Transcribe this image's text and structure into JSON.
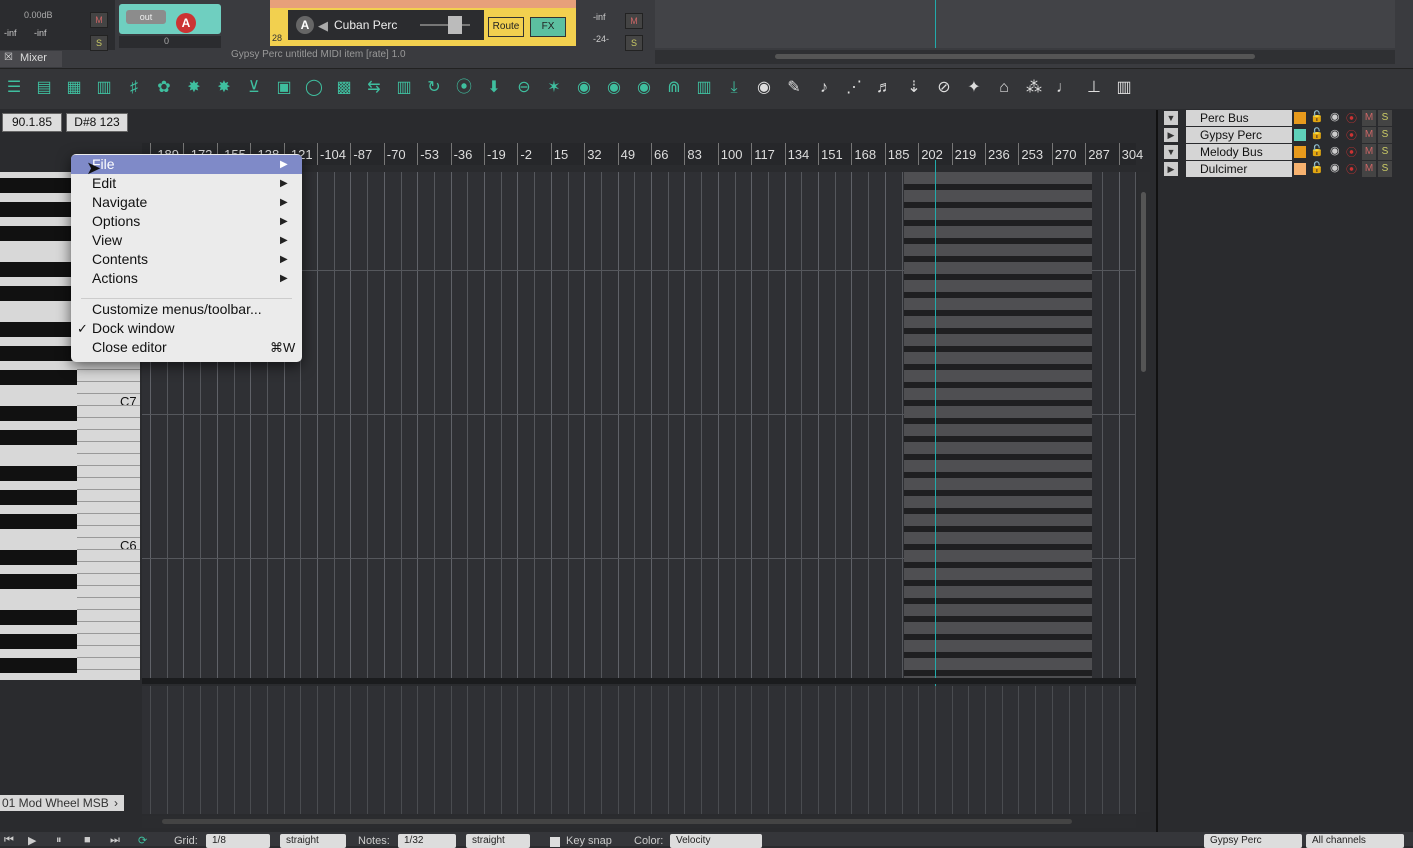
{
  "mixer": {
    "level": "0.00dB",
    "inf_left": "-inf",
    "inf_right": "-inf",
    "out_label": "out",
    "a_label": "A",
    "mute": "M",
    "solo": "S",
    "pan_value": "0",
    "tab_label": "Mixer",
    "track_number": "28",
    "track_name": "Cuban Perc",
    "route_label": "Route",
    "fx_label": "FX",
    "meter_top": "-inf",
    "meter_bottom": "-24-"
  },
  "editor_title": "Gypsy Perc untitled MIDI item [rate] 1.0",
  "position": {
    "time": "90.1.85",
    "note": "D#8",
    "velocity": "123"
  },
  "ruler_ticks": [
    "-189",
    "-172",
    "-155",
    "-138",
    "-121",
    "-104",
    "-87",
    "-70",
    "-53",
    "-36",
    "-19",
    "-2",
    "15",
    "32",
    "49",
    "66",
    "83",
    "100",
    "117",
    "134",
    "151",
    "168",
    "185",
    "202",
    "219",
    "236",
    "253",
    "270",
    "287",
    "304"
  ],
  "key_labels": {
    "c7": "C7",
    "c6": "C6"
  },
  "cc_lane": "01 Mod Wheel MSB",
  "tracks": [
    {
      "name": "Perc Bus",
      "color": "#e89a1c",
      "folder": true
    },
    {
      "name": "Gypsy Perc",
      "color": "#5fd1b9",
      "folder": false
    },
    {
      "name": "Melody Bus",
      "color": "#e89a1c",
      "folder": true
    },
    {
      "name": "Dulcimer",
      "color": "#f7b26f",
      "folder": false
    }
  ],
  "context_menu": {
    "items": [
      {
        "label": "File",
        "submenu": true
      },
      {
        "label": "Edit",
        "submenu": true
      },
      {
        "label": "Navigate",
        "submenu": true
      },
      {
        "label": "Options",
        "submenu": true
      },
      {
        "label": "View",
        "submenu": true
      },
      {
        "label": "Contents",
        "submenu": true
      },
      {
        "label": "Actions",
        "submenu": true
      }
    ],
    "customize": "Customize menus/toolbar...",
    "dock": "Dock window",
    "dock_check": "✓",
    "close": "Close editor",
    "close_shortcut": "⌘W",
    "arrow": "▶"
  },
  "bottom_bar": {
    "grid_label": "Grid:",
    "grid_value": "1/8",
    "grid_mode": "straight",
    "notes_label": "Notes:",
    "notes_value": "1/32",
    "notes_mode": "straight",
    "key_snap": "Key snap",
    "color_label": "Color:",
    "color_value": "Velocity",
    "track_select": "Gypsy Perc",
    "channel_select": "All channels"
  }
}
